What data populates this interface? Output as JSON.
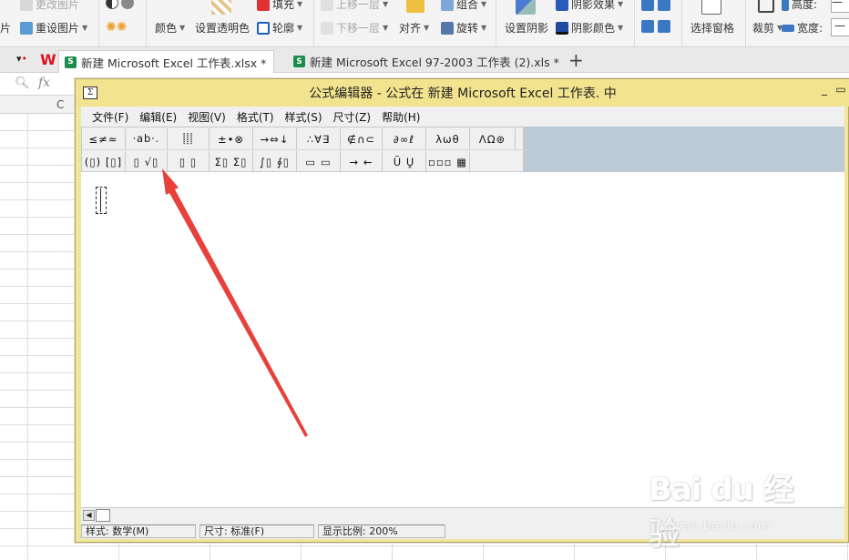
{
  "ribbon": {
    "items": [
      {
        "id": "change-pic",
        "label": "更改图片"
      },
      {
        "id": "pic-left",
        "label": "片"
      },
      {
        "id": "reset-pic",
        "label": "重设图片"
      },
      {
        "id": "color",
        "label": "颜色"
      },
      {
        "id": "set-transparent",
        "label": "设置透明色"
      },
      {
        "id": "fill",
        "label": "填充"
      },
      {
        "id": "outline",
        "label": "轮廓"
      },
      {
        "id": "bring-forward",
        "label": "上移一层"
      },
      {
        "id": "send-backward",
        "label": "下移一层"
      },
      {
        "id": "align",
        "label": "对齐"
      },
      {
        "id": "group",
        "label": "组合"
      },
      {
        "id": "rotate",
        "label": "旋转"
      },
      {
        "id": "shadow-effect",
        "label": "阴影效果"
      },
      {
        "id": "set-shadow",
        "label": "设置阴影"
      },
      {
        "id": "shadow-color",
        "label": "阴影颜色"
      },
      {
        "id": "selection-pane",
        "label": "选择窗格"
      },
      {
        "id": "crop",
        "label": "裁剪"
      },
      {
        "id": "height",
        "label": "高度:"
      },
      {
        "id": "width",
        "label": "宽度:"
      }
    ]
  },
  "tabs": [
    {
      "label": "新建 Microsoft Excel 工作表.xlsx *"
    },
    {
      "label": "新建 Microsoft Excel 97-2003 工作表 (2).xls *"
    }
  ],
  "tab_add": "+",
  "sheet": {
    "fx": "fx",
    "column": "C"
  },
  "equation_editor": {
    "title": "公式编辑器 - 公式在 新建 Microsoft Excel 工作表. 中",
    "app_icon": "Σ",
    "menu": [
      "文件(F)",
      "编辑(E)",
      "视图(V)",
      "格式(T)",
      "样式(S)",
      "尺寸(Z)",
      "帮助(H)"
    ],
    "palette_row1": [
      "≤≠≈",
      "⸱ab⸱.",
      "⸽⸽⸽",
      "±•⊗",
      "→⇔↓",
      "∴∀∃",
      "∉∩⊂",
      "∂∞ℓ",
      "λωθ",
      "ΛΩ⊛"
    ],
    "palette_row2": [
      "(▯) [▯]",
      "▯ √▯",
      "▯ ▯",
      "Σ▯ Σ▯",
      "∫▯ ∮▯",
      "▭ ▭",
      "→ ←",
      "Ũ Ṷ",
      "▫▫▫ ▦"
    ],
    "status": {
      "style": "样式: 数学(M)",
      "size": "尺寸: 标准(F)",
      "zoom": "显示比例: 200%"
    }
  },
  "watermark": {
    "brand": "Bai du 经验",
    "sub": "jingyan.baidu.com"
  },
  "colors": {
    "title_bar": "#f2e48e",
    "toolbar_bg": "#bccad6",
    "arrow": "#e8413b"
  }
}
